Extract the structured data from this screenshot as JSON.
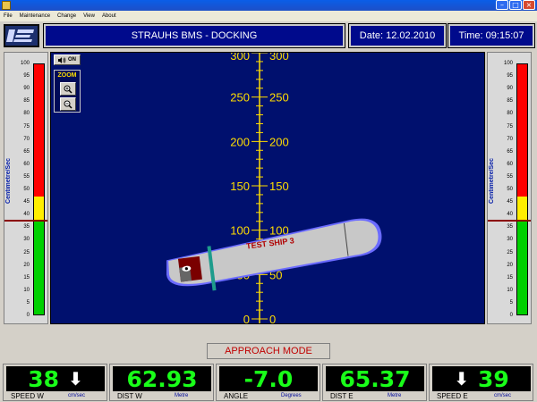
{
  "menu": [
    "File",
    "Maintenance",
    "Change",
    "View",
    "About"
  ],
  "header": {
    "title": "STRAUHS BMS - DOCKING",
    "date": "Date: 12.02.2010",
    "time": "Time: 09:15:07"
  },
  "side_scale": {
    "ticks": [
      "100",
      "95",
      "90",
      "85",
      "80",
      "75",
      "70",
      "65",
      "60",
      "55",
      "50",
      "45",
      "40",
      "35",
      "30",
      "25",
      "20",
      "15",
      "10",
      "5",
      "0"
    ],
    "label": "Centimetre/Sec",
    "green_to": 38,
    "yellow_to": 47,
    "marker": 38
  },
  "view": {
    "sound_label": "ON",
    "zoom_label": "ZOOM",
    "ruler_ticks": [
      "300",
      "250",
      "200",
      "150",
      "100",
      "50",
      "0"
    ],
    "vessel_name": "TEST SHIP 3"
  },
  "mode": "APPROACH MODE",
  "readouts": [
    {
      "name": "SPEED W",
      "value": "38",
      "unit": "cm/sec",
      "arrow": "down-after"
    },
    {
      "name": "DIST W",
      "value": "62.93",
      "unit": "Metre",
      "arrow": "none"
    },
    {
      "name": "ANGLE",
      "value": "-7.0",
      "unit": "Degrees",
      "arrow": "none"
    },
    {
      "name": "DIST E",
      "value": "65.37",
      "unit": "Metre",
      "arrow": "none"
    },
    {
      "name": "SPEED E",
      "value": "39",
      "unit": "cm/sec",
      "arrow": "down-before"
    }
  ],
  "colors": {
    "panel_blue": "#000a8c",
    "view_blue": "#00106e",
    "ruler_yellow": "#ffdd00",
    "readout_green": "#19ff19",
    "bar_green": "#00d000",
    "bar_yellow": "#ffee00",
    "bar_red": "#ff0000",
    "mode_red": "#c00000"
  }
}
